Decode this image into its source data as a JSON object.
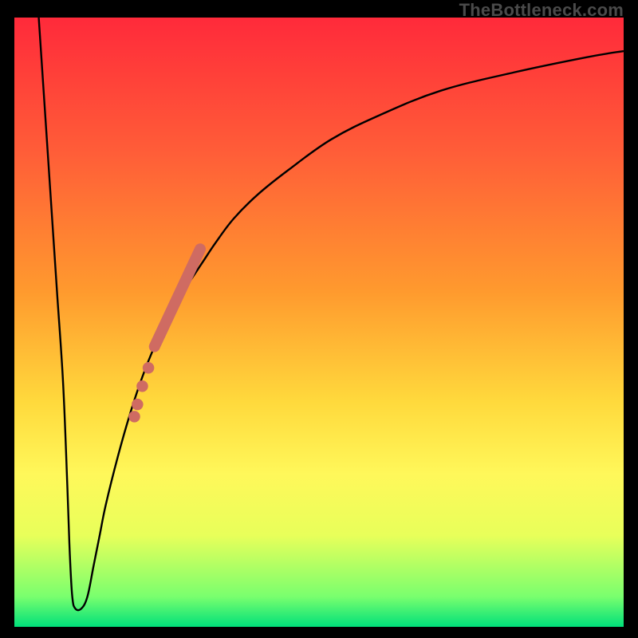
{
  "watermark": "TheBottleneck.com",
  "colors": {
    "curve_stroke": "#000000",
    "marker_fill": "#cf6b62",
    "marker_stroke": "#cf6b62"
  },
  "chart_data": {
    "type": "line",
    "title": "",
    "xlabel": "",
    "ylabel": "",
    "xlim": [
      0,
      100
    ],
    "ylim": [
      0,
      100
    ],
    "grid": false,
    "legend": false,
    "series": [
      {
        "name": "bottleneck-curve",
        "x": [
          4,
          5,
          6,
          7,
          8,
          8.7,
          9.1,
          9.5,
          10,
          11,
          12,
          13,
          14,
          15,
          17,
          19,
          21,
          23,
          25,
          26,
          27,
          29,
          31,
          33,
          36,
          40,
          45,
          52,
          60,
          70,
          82,
          94,
          100
        ],
        "y": [
          100,
          85,
          70,
          55,
          40,
          23,
          12,
          5,
          3,
          3,
          5,
          10,
          15,
          20,
          28,
          35,
          41,
          46,
          50,
          52,
          54,
          57,
          60,
          63,
          67,
          71,
          75,
          80,
          84,
          88,
          91,
          93.5,
          94.5
        ]
      }
    ],
    "markers": {
      "name": "highlighted-range",
      "thick_segment": {
        "x": [
          23,
          30.5
        ],
        "y": [
          46,
          62
        ]
      },
      "dots": [
        {
          "x": 22.0,
          "y": 42.5
        },
        {
          "x": 21.0,
          "y": 39.5
        },
        {
          "x": 20.2,
          "y": 36.5
        },
        {
          "x": 19.7,
          "y": 34.5
        }
      ]
    }
  }
}
